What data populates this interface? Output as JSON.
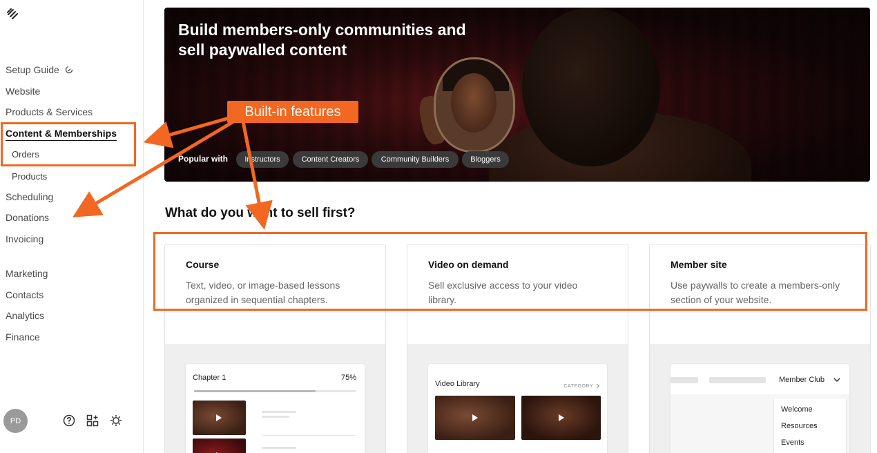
{
  "sidebar": {
    "items": [
      {
        "label": "Setup Guide"
      },
      {
        "label": "Website"
      },
      {
        "label": "Products & Services"
      },
      {
        "label": "Content & Memberships"
      },
      {
        "label": "Orders"
      },
      {
        "label": "Products"
      },
      {
        "label": "Scheduling"
      },
      {
        "label": "Donations"
      },
      {
        "label": "Invoicing"
      },
      {
        "label": "Marketing"
      },
      {
        "label": "Contacts"
      },
      {
        "label": "Analytics"
      },
      {
        "label": "Finance"
      }
    ],
    "avatar_initials": "PD",
    "footer_icons": [
      "help-icon",
      "apps-icon",
      "settings-icon"
    ]
  },
  "hero": {
    "title": "Build members-only communities and sell paywalled content",
    "popular_label": "Popular with",
    "chips": [
      "Instructors",
      "Content Creators",
      "Community Builders",
      "Bloggers"
    ]
  },
  "section": {
    "title": "What do you want to sell first?"
  },
  "cards": [
    {
      "title": "Course",
      "description": "Text, video, or image-based lessons organized in sequential chapters.",
      "preview": {
        "chapter": "Chapter 1",
        "progress_text": "75%",
        "progress": 0.75
      }
    },
    {
      "title": "Video on demand",
      "description": "Sell exclusive access to your video library.",
      "preview": {
        "library": "Video Library",
        "category": "CATEGORY"
      }
    },
    {
      "title": "Member site",
      "description": "Use paywalls to create a members-only section of your website.",
      "preview": {
        "club": "Member Club",
        "menu": [
          "Welcome",
          "Resources",
          "Events"
        ]
      }
    }
  ],
  "annotation": {
    "callout": "Built-in features",
    "color": "#f26722"
  }
}
